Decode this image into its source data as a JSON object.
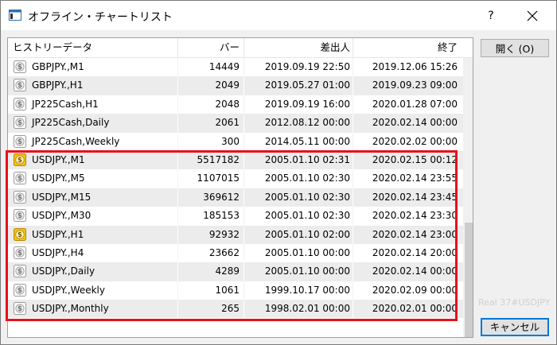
{
  "window": {
    "title": "オフライン・チャートリスト",
    "help_label": "?",
    "icon": "window-app-icon"
  },
  "table": {
    "columns": [
      "ヒストリーデータ",
      "バー",
      "差出人",
      "終了"
    ],
    "rows": [
      {
        "name": "GBPJPY.,M1",
        "bars": "14449",
        "from": "2019.09.19 22:50",
        "to": "2019.12.06 15:26",
        "icon": "gray"
      },
      {
        "name": "GBPJPY.,H1",
        "bars": "2049",
        "from": "2019.05.27 01:00",
        "to": "2019.09.23 09:00",
        "icon": "gray"
      },
      {
        "name": "JP225Cash,H1",
        "bars": "2048",
        "from": "2019.09.19 16:00",
        "to": "2020.01.28 07:00",
        "icon": "gray"
      },
      {
        "name": "JP225Cash,Daily",
        "bars": "2061",
        "from": "2012.08.12 00:00",
        "to": "2020.02.14 00:00",
        "icon": "gray"
      },
      {
        "name": "JP225Cash,Weekly",
        "bars": "300",
        "from": "2014.05.11 00:00",
        "to": "2020.02.02 00:00",
        "icon": "gray"
      },
      {
        "name": "USDJPY.,M1",
        "bars": "5517182",
        "from": "2005.01.10 02:31",
        "to": "2020.02.15 00:12",
        "icon": "gold"
      },
      {
        "name": "USDJPY.,M5",
        "bars": "1107015",
        "from": "2005.01.10 02:30",
        "to": "2020.02.14 23:55",
        "icon": "gray"
      },
      {
        "name": "USDJPY.,M15",
        "bars": "369612",
        "from": "2005.01.10 02:30",
        "to": "2020.02.14 23:45",
        "icon": "gray"
      },
      {
        "name": "USDJPY.,M30",
        "bars": "185153",
        "from": "2005.01.10 02:30",
        "to": "2020.02.14 23:30",
        "icon": "gray"
      },
      {
        "name": "USDJPY.,H1",
        "bars": "92932",
        "from": "2005.01.10 02:00",
        "to": "2020.02.14 23:00",
        "icon": "gold"
      },
      {
        "name": "USDJPY.,H4",
        "bars": "23662",
        "from": "2005.01.10 00:00",
        "to": "2020.02.14 20:00",
        "icon": "gray"
      },
      {
        "name": "USDJPY.,Daily",
        "bars": "4289",
        "from": "2005.01.10 00:00",
        "to": "2020.02.14 00:00",
        "icon": "gray"
      },
      {
        "name": "USDJPY.,Weekly",
        "bars": "1061",
        "from": "1999.10.17 00:00",
        "to": "2020.02.09 00:00",
        "icon": "gray"
      },
      {
        "name": "USDJPY.,Monthly",
        "bars": "265",
        "from": "1998.02.01 00:00",
        "to": "2020.02.01 00:00",
        "icon": "gray"
      }
    ]
  },
  "buttons": {
    "open_label": "開く (O)",
    "cancel_label": "キャンセル"
  },
  "watermark": "Real 37#USDJPY",
  "colors": {
    "highlight": "#e8101a",
    "icon_gold": "#f1c40f",
    "icon_gray": "#c8c8c8",
    "focus_border": "#0078d7"
  }
}
